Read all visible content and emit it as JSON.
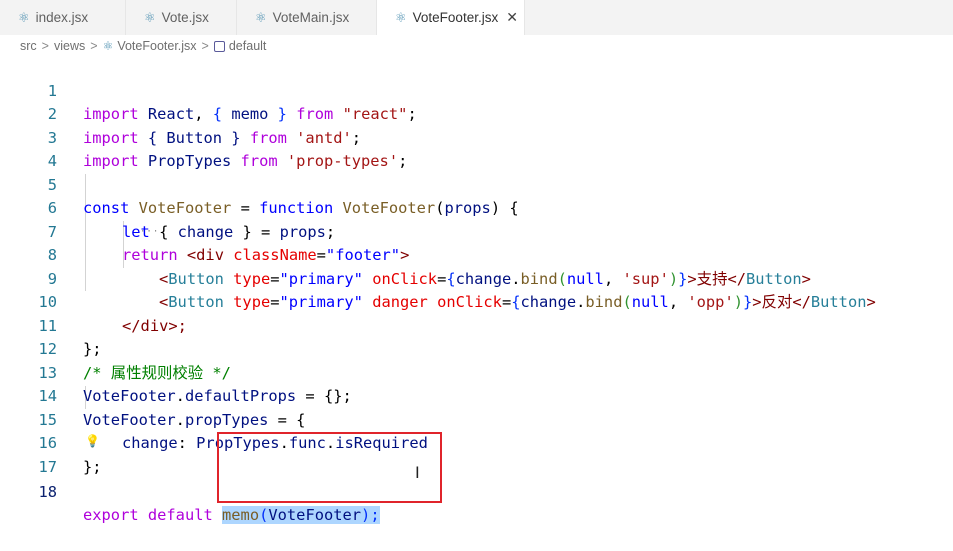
{
  "tabs": [
    {
      "label": "index.jsx",
      "active": false
    },
    {
      "label": "Vote.jsx",
      "active": false
    },
    {
      "label": "VoteMain.jsx",
      "active": false
    },
    {
      "label": "VoteFooter.jsx",
      "active": true
    }
  ],
  "tab_icon": "⚛",
  "close_icon": "✕",
  "breadcrumb": {
    "parts": [
      "src",
      "views",
      "VoteFooter.jsx",
      "default"
    ],
    "separator": ">"
  },
  "line_numbers": [
    "1",
    "2",
    "3",
    "4",
    "5",
    "6",
    "7",
    "8",
    "9",
    "10",
    "11",
    "12",
    "13",
    "14",
    "15",
    "16",
    "17",
    "18"
  ],
  "code": {
    "l1": {
      "kw": "import",
      "a": "React",
      "b": ", ",
      "c": "{",
      "d": " memo ",
      "e": "}",
      "f": " from ",
      "g": "\"react\"",
      "h": ";"
    },
    "l2": {
      "kw": "import",
      "a": " { Button } ",
      "f": "from ",
      "g": "'antd'",
      "h": ";"
    },
    "l3": {
      "kw": "import",
      "a": " PropTypes ",
      "f": "from ",
      "g": "'prop-types'",
      "h": ";"
    },
    "l5": {
      "kw": "const",
      "a": "VoteFooter",
      "b": " = ",
      "c": "function",
      "d": " ",
      "e": "VoteFooter",
      "f": "(",
      "g": "props",
      "h": ") {"
    },
    "l6": {
      "kw": "let",
      "a": " { ",
      "b": "change",
      "c": " } = ",
      "d": "props",
      "e": ";"
    },
    "l7": {
      "kw": "return",
      "a": " <",
      "b": "div",
      "c": " className",
      "d": "=",
      "e": "\"footer\"",
      "f": ">"
    },
    "l8": {
      "a": "<",
      "b": "Button",
      "c": " type",
      "d": "=",
      "e": "\"primary\"",
      "f": " onClick",
      "g": "=",
      "h": "{",
      "i": "change",
      "j": ".",
      "k": "bind",
      "l": "(",
      "m": "null",
      "n": ", ",
      "o": "'sup'",
      "p": ")",
      "q": "}",
      "r": ">支持</",
      "s": "Button",
      "t": ">"
    },
    "l9": {
      "a": "<",
      "b": "Button",
      "c": " type",
      "d": "=",
      "e": "\"primary\"",
      "f": " danger",
      "g": " onClick",
      "h": "=",
      "i": "{",
      "j": "change",
      "k": ".",
      "l": "bind",
      "m": "(",
      "n": "null",
      "o": ", ",
      "p": "'opp'",
      "q": ")",
      "r": "}",
      "s": ">反对</",
      "t": "Button",
      "u": ">"
    },
    "l10": {
      "a": "</",
      "b": "div",
      "c": ">;"
    },
    "l11": {
      "a": "};"
    },
    "l12": {
      "a": "/* 属性规则校验 */"
    },
    "l13": {
      "a": "VoteFooter",
      "b": ".",
      "c": "defaultProps",
      "d": " = {};"
    },
    "l14": {
      "a": "VoteFooter",
      "b": ".",
      "c": "propTypes",
      "d": " = {"
    },
    "l15": {
      "a": "change",
      "b": ": ",
      "c": "PropTypes",
      "d": ".",
      "e": "func",
      "f": ".",
      "g": "isRequired"
    },
    "l16": {
      "a": "};"
    },
    "l18": {
      "kw": "export",
      "a": " default ",
      "b": "memo",
      "c": "(",
      "d": "VoteFooter",
      "e": ");"
    }
  },
  "colors": {
    "highlight_box": "#e0242b",
    "selection": "#add6ff"
  },
  "icons": {
    "lightbulb": "💡",
    "text_cursor": "I"
  }
}
